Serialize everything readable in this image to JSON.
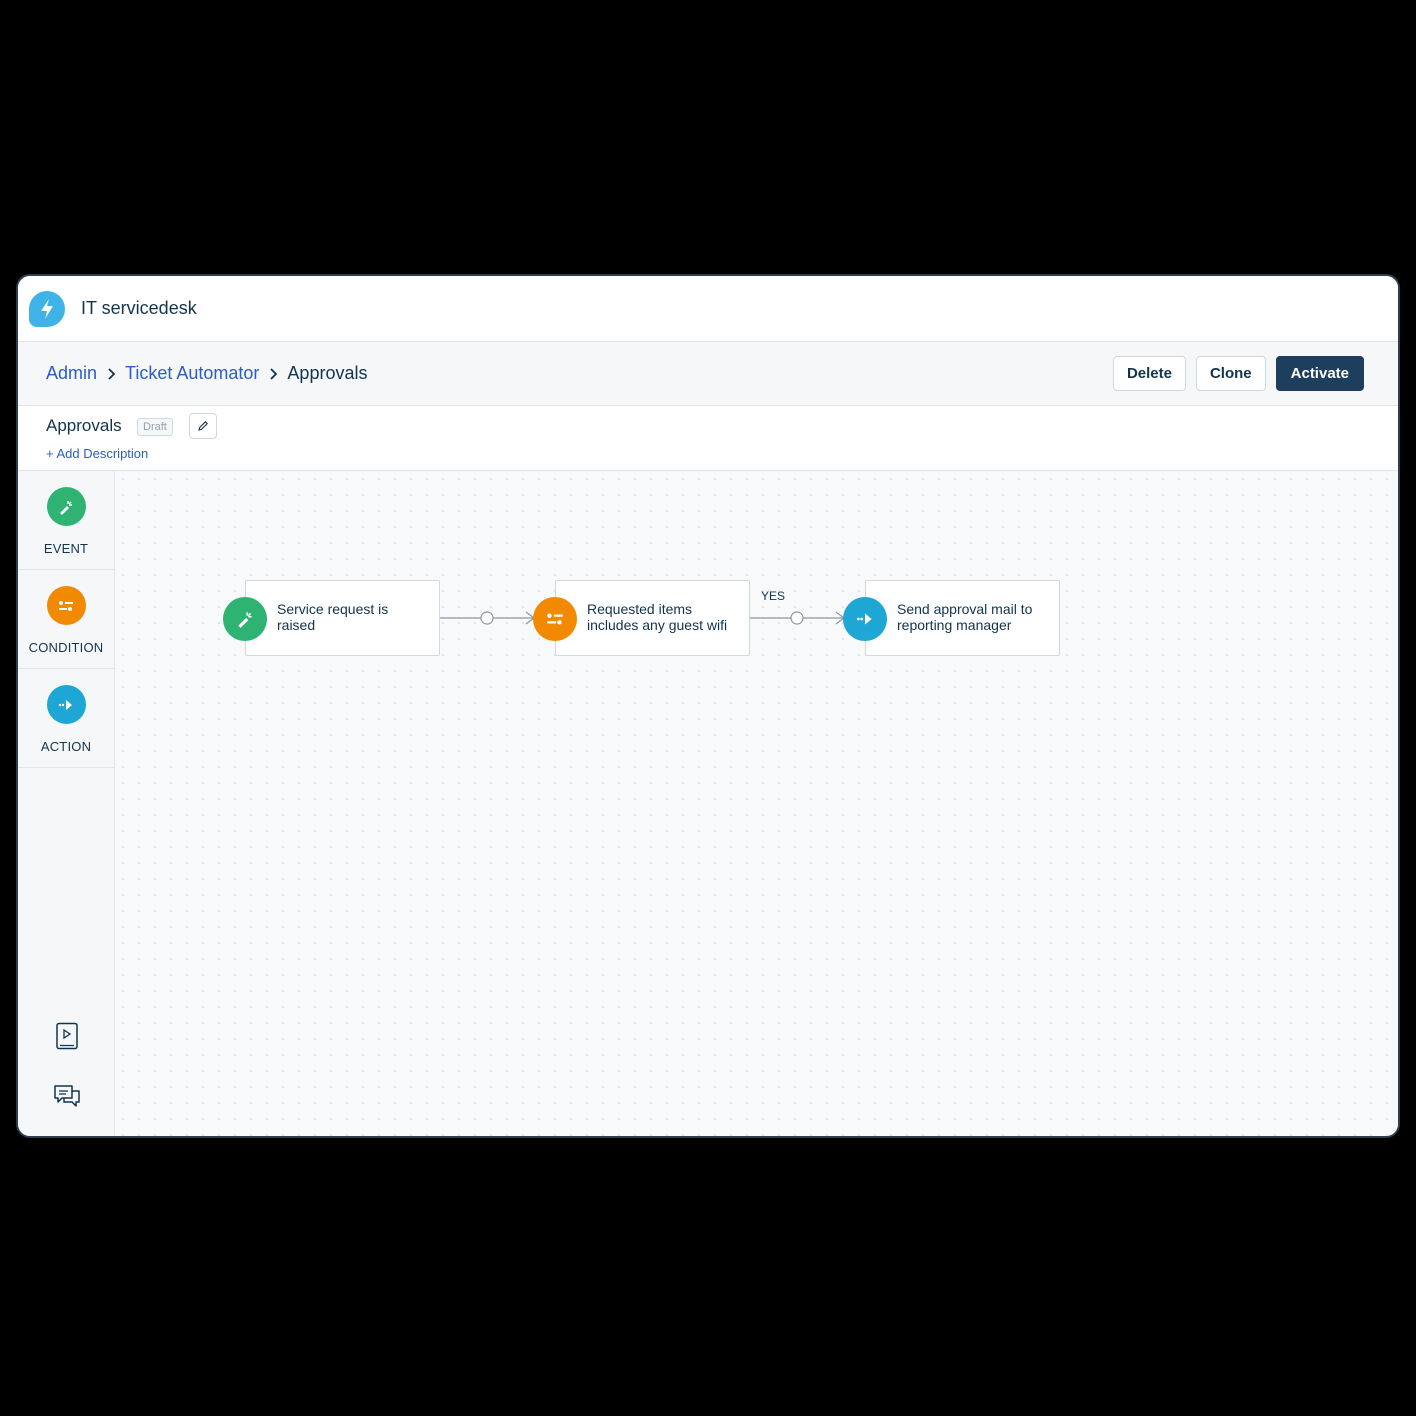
{
  "app": {
    "title": "IT servicedesk"
  },
  "breadcrumb": {
    "items": [
      "Admin",
      "Ticket Automator"
    ],
    "current": "Approvals"
  },
  "actions": {
    "delete": "Delete",
    "clone": "Clone",
    "activate": "Activate"
  },
  "workflow": {
    "name": "Approvals",
    "status": "Draft",
    "add_description": "+ Add Description"
  },
  "sidebar": {
    "tools": [
      {
        "label": "EVENT",
        "icon": "event-icon"
      },
      {
        "label": "CONDITION",
        "icon": "condition-icon"
      },
      {
        "label": "ACTION",
        "icon": "action-icon"
      }
    ],
    "utilities": [
      "video-tutorial-icon",
      "chat-icon"
    ]
  },
  "canvas": {
    "nodes": [
      {
        "type": "event",
        "text": "Service request is raised"
      },
      {
        "type": "condition",
        "text": "Requested items includes any guest wifi"
      },
      {
        "type": "action",
        "text": "Send approval mail to reporting manager"
      }
    ],
    "branch_label": "YES"
  },
  "colors": {
    "event": "#2fb373",
    "condition": "#f18a00",
    "action": "#1ea6d5",
    "primary": "#1d3e5c",
    "link": "#2c5cc5"
  }
}
